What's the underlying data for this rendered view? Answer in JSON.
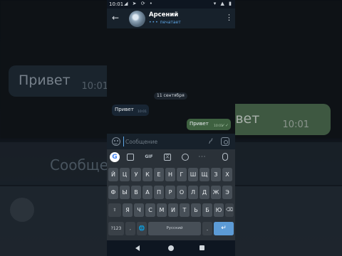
{
  "status_bar": {
    "time": "10:01",
    "left_icons": [
      "telegram-icon",
      "send-icon",
      "refresh-icon",
      "dot-icon"
    ],
    "right_icons": [
      "signal-icon",
      "wifi-icon",
      "battery-icon"
    ]
  },
  "chat_header": {
    "contact_name": "Арсений",
    "status": "печатает",
    "back_icon": "arrow-left-icon",
    "menu_icon": "more-vertical-icon"
  },
  "chat": {
    "date_separator": "11 сентября",
    "messages": [
      {
        "direction": "incoming",
        "text": "Привет",
        "time": "10:01"
      },
      {
        "direction": "outgoing",
        "text": "Привет",
        "time": "10:01",
        "read": true
      }
    ]
  },
  "composer": {
    "placeholder": "Сообщение",
    "value": "",
    "emoji_icon": "smile-icon",
    "attach_icon": "paperclip-icon",
    "camera_icon": "camera-icon"
  },
  "keyboard": {
    "toolbar": {
      "google_label": "G",
      "gif_label": "GIF",
      "more_label": "···"
    },
    "rows": [
      [
        "Й",
        "Ц",
        "У",
        "К",
        "Е",
        "Н",
        "Г",
        "Ш",
        "Щ",
        "З",
        "Х"
      ],
      [
        "Ф",
        "Ы",
        "В",
        "А",
        "П",
        "Р",
        "О",
        "Л",
        "Д",
        "Ж",
        "Э"
      ],
      [
        "Я",
        "Ч",
        "С",
        "М",
        "И",
        "Т",
        "Ь",
        "Б",
        "Ю"
      ]
    ],
    "bottom": {
      "symbols_label": "?123",
      "comma_label": ",",
      "space_label": "Русский",
      "period_label": ".",
      "enter_label": "↵",
      "shift_label": "⇧",
      "backspace_label": "⌫",
      "globe_label": "🌐"
    }
  },
  "background": {
    "blur_incoming_text": "Привет",
    "blur_incoming_time": "10:01",
    "blur_outgoing_text": "ивет",
    "blur_outgoing_time": "10:01",
    "blur_input_text": "Сообще"
  }
}
